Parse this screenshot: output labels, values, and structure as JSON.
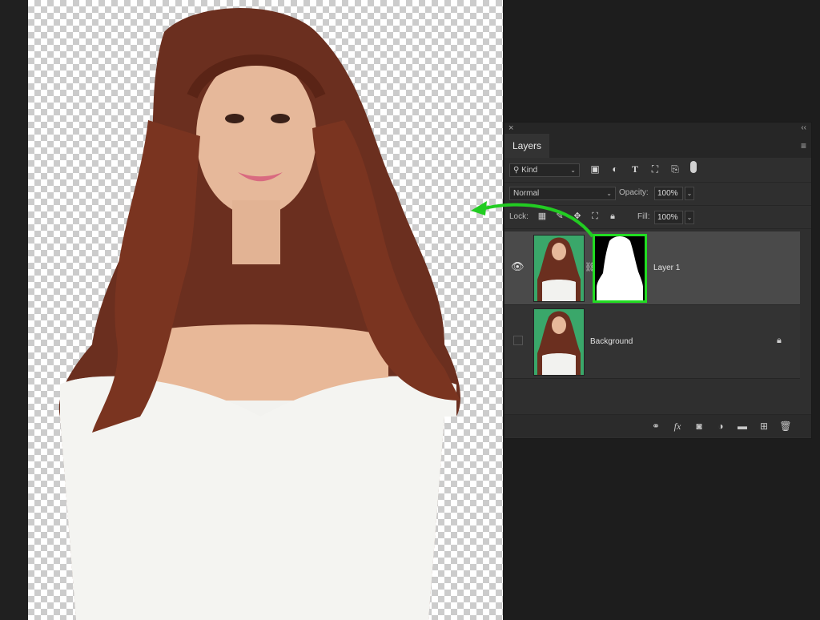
{
  "panel": {
    "close_glyph": "×",
    "collapse_glyph": "‹‹",
    "tab_label": "Layers",
    "menu_glyph": "≡"
  },
  "filter": {
    "kind_label": "Kind",
    "search_glyph": "⚲",
    "caret": "⌄",
    "icons": [
      "image-filter-icon",
      "adjustment-filter-icon",
      "type-filter-icon",
      "shape-filter-icon",
      "smart-object-filter-icon"
    ]
  },
  "blend": {
    "mode": "Normal",
    "opacity_label": "Opacity:",
    "opacity_value": "100%",
    "lock_label": "Lock:",
    "fill_label": "Fill:",
    "fill_value": "100%"
  },
  "layers": [
    {
      "name": "Layer 1",
      "visible": true,
      "has_mask": true,
      "selected": true
    },
    {
      "name": "Background",
      "visible": false,
      "locked": true
    }
  ],
  "footer_icons": [
    "link-icon",
    "fx-icon",
    "add-mask-icon",
    "adjustment-icon",
    "folder-icon",
    "new-layer-icon",
    "trash-icon"
  ],
  "colors": {
    "highlight": "#22dd22",
    "panel_bg": "#2f2f2f",
    "selected_layer": "#4a4a4a",
    "greenscreen": "#3aa76a"
  }
}
